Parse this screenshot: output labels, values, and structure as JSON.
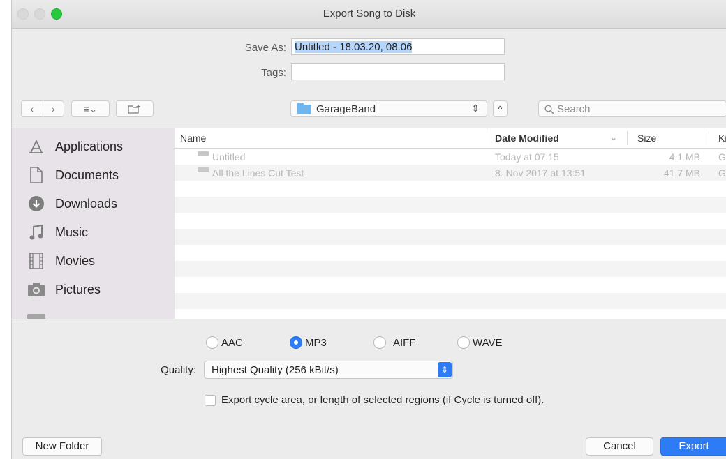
{
  "window": {
    "title": "Export Song to Disk"
  },
  "form": {
    "save_as_label": "Save As:",
    "save_as_value": "Untitled - 18.03.20, 08.06",
    "tags_label": "Tags:",
    "tags_value": ""
  },
  "toolbar": {
    "back_glyph": "‹",
    "forward_glyph": "›",
    "view_glyph": "≡⌄",
    "location": "GarageBand",
    "search_placeholder": "Search"
  },
  "sidebar": {
    "items": [
      {
        "label": "Applications",
        "icon": "applications-icon"
      },
      {
        "label": "Documents",
        "icon": "documents-icon"
      },
      {
        "label": "Downloads",
        "icon": "downloads-icon"
      },
      {
        "label": "Music",
        "icon": "music-icon"
      },
      {
        "label": "Movies",
        "icon": "movies-icon"
      },
      {
        "label": "Pictures",
        "icon": "pictures-icon"
      }
    ]
  },
  "file_list": {
    "columns": {
      "name": "Name",
      "date": "Date Modified",
      "size": "Size",
      "kind": "Ki"
    },
    "rows": [
      {
        "name": "Untitled",
        "date": "Today at 07:15",
        "size": "4,1 MB",
        "kind": "Ga"
      },
      {
        "name": "All the Lines Cut Test",
        "date": "8. Nov 2017 at 13:51",
        "size": "41,7 MB",
        "kind": "Ga"
      }
    ]
  },
  "format": {
    "options": [
      "AAC",
      "MP3",
      "AIFF",
      "WAVE"
    ],
    "selected": "MP3"
  },
  "quality": {
    "label": "Quality:",
    "value": "Highest Quality (256 kBit/s)"
  },
  "cycle_option": {
    "label": "Export cycle area, or length of selected regions (if Cycle is turned off).",
    "checked": false
  },
  "buttons": {
    "new_folder": "New Folder",
    "cancel": "Cancel",
    "export": "Export"
  },
  "colors": {
    "accent": "#2d7cf6",
    "selection": "#b5d5fb",
    "sidebar": "#e8e3e8"
  }
}
